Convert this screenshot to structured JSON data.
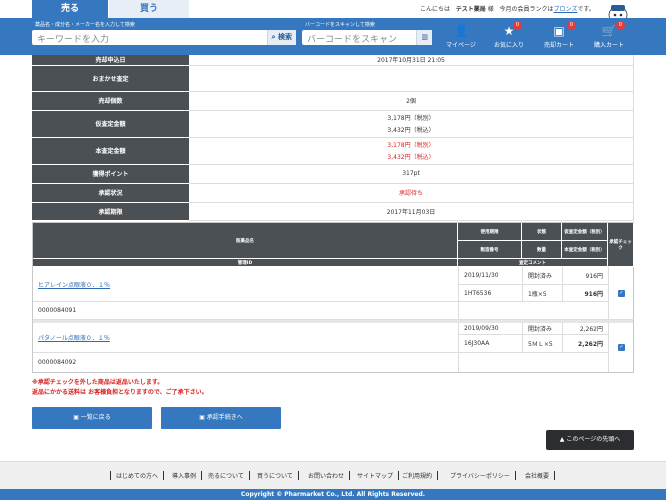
{
  "tabs": {
    "sell": "売る",
    "buy": "買う"
  },
  "greeting": {
    "pre": "こんにちは",
    "name": "テスト薬局",
    "honorific": "様",
    "rank_pre": "今月の会員ランクは",
    "rank": "ブロンズ",
    "rank_post": "です。"
  },
  "search": {
    "hint": "薬品名・成分名・メーカー名を入力して検索",
    "placeholder": "キーワードを入力",
    "button": "検索"
  },
  "barcode": {
    "hint": "バーコードをスキャンして検索",
    "placeholder": "バーコードをスキャン"
  },
  "nav": [
    {
      "label": "マイページ",
      "icon": "user-icon",
      "badge": ""
    },
    {
      "label": "お気に入り",
      "icon": "star-icon",
      "badge": "0"
    },
    {
      "label": "売却カート",
      "icon": "box-icon",
      "badge": "0"
    },
    {
      "label": "購入カート",
      "icon": "cart-icon",
      "badge": "0"
    }
  ],
  "info_rows": [
    {
      "label": "売却申込日",
      "value": "2017年10月31日 21:05"
    },
    {
      "label": "おまかせ査定",
      "value": ""
    },
    {
      "label": "売却個数",
      "value": "2個"
    },
    {
      "label": "仮査定金額",
      "value1": "3,178円（税別）",
      "value2": "3,432円（税込）"
    },
    {
      "label": "本査定金額",
      "value1": "3,178円（税別）",
      "value2": "3,432円（税込）"
    },
    {
      "label": "獲得ポイント",
      "value": "317pt"
    },
    {
      "label": "承認状況",
      "value": "承認待ち"
    },
    {
      "label": "承認期限",
      "value": "2017年11月03日"
    }
  ],
  "item_headers": {
    "name": "医薬品名",
    "expiry": "使用期限",
    "state": "状態",
    "prov": "仮査定金額（税別）",
    "approve": "承認チェック",
    "lot": "製造番号",
    "qty": "数量",
    "final": "本査定金額（税別）",
    "mgmt": "管理ID",
    "comment": "査定コメント"
  },
  "items": [
    {
      "name": "ヒアレイン点眼液０．１％",
      "expiry": "2019/11/30",
      "state": "開封済み",
      "prov": "916円",
      "lot": "1HT6536",
      "qty": "1瓶×5",
      "final": "916円",
      "id": "0000084091",
      "checked": "✓"
    },
    {
      "name": "パタノール点眼液０．１％",
      "expiry": "2019/09/30",
      "state": "開封済み",
      "prov": "2,262円",
      "lot": "16J30AA",
      "qty": "5ＭＬ×5",
      "final": "2,262円",
      "id": "0000084092",
      "checked": "✓"
    }
  ],
  "notes": [
    "※承認チェックを外した商品は返品いたします。",
    "返品にかかる送料は お客様負担となりますので、ご了承下さい。"
  ],
  "buttons": {
    "back": "一覧に戻る",
    "approve": "承認手続きへ",
    "totop": "このページの先頭へ"
  },
  "footer": [
    "はじめての方へ",
    "導入事例",
    "売るについて",
    "買うについて",
    "お問い合わせ",
    "サイトマップ",
    "ご利用規約",
    "プライバシーポリシー",
    "会社概要"
  ],
  "copyright": "Copyright © Pharmarket Co., Ltd. All Rights Reserved.",
  "colors": {
    "primary": "#3678c0",
    "header_dark": "#4b5055",
    "alert": "#e02020"
  }
}
